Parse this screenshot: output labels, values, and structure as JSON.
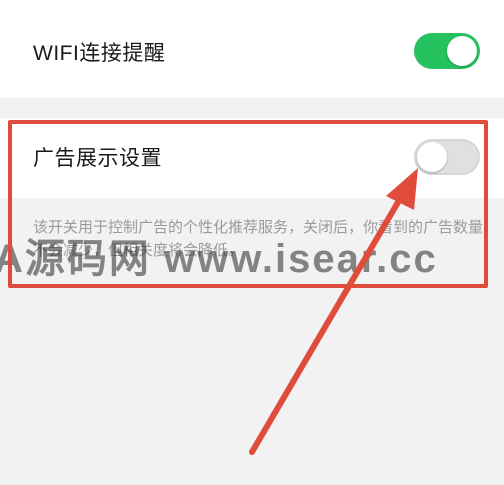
{
  "settings": {
    "wifi": {
      "label": "WIFI连接提醒",
      "enabled": true
    },
    "ads": {
      "label": "广告展示设置",
      "enabled": false,
      "description": "该开关用于控制广告的个性化推荐服务，关闭后，你看到的广告数量不会减少，但相关度将会降低。"
    }
  },
  "watermark": "A源码网 www.isear.cc",
  "colors": {
    "toggle_on": "#25c25f",
    "toggle_off": "#e0e0e0",
    "annotation": "#e04c3c",
    "background": "#f2f2f2"
  }
}
